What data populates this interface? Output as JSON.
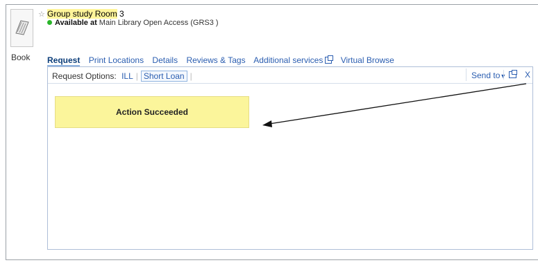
{
  "item": {
    "title_parts": [
      "Group study ",
      "Room",
      " 3"
    ],
    "availability_status": "Available at",
    "availability_location": "Main Library Open Access (GRS3 )",
    "format_label": "Book",
    "status_color": "#2ab52a"
  },
  "tabs": [
    {
      "label": "Request",
      "active": true
    },
    {
      "label": "Print Locations",
      "active": false
    },
    {
      "label": "Details",
      "active": false
    },
    {
      "label": "Reviews & Tags",
      "active": false
    },
    {
      "label": "Additional services",
      "active": false,
      "external": true
    },
    {
      "label": "Virtual Browse",
      "active": false
    }
  ],
  "panel": {
    "request_options_label": "Request Options:",
    "options": [
      "ILL",
      "Short Loan"
    ],
    "send_to_label": "Send to",
    "close_label": "X",
    "message": "Action Succeeded"
  },
  "colors": {
    "link": "#2a5db0",
    "success_bg": "#fbf59b",
    "highlight": "#fff59a"
  }
}
